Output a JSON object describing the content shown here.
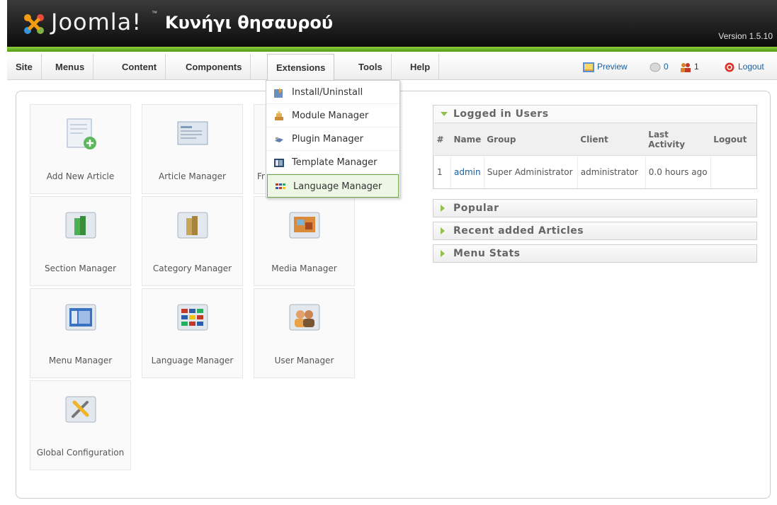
{
  "header": {
    "logo_text": "Joomla!",
    "logo_tm": "™",
    "site_name": "Κυνήγι θησαυρού",
    "version": "Version 1.5.10"
  },
  "menubar": {
    "items": [
      {
        "label": "Site"
      },
      {
        "label": "Menus"
      },
      {
        "label": "Content"
      },
      {
        "label": "Components"
      },
      {
        "label": "Extensions"
      },
      {
        "label": "Tools"
      },
      {
        "label": "Help"
      }
    ],
    "preview_label": "Preview",
    "messages_count": "0",
    "users_count": "1",
    "logout_label": "Logout"
  },
  "extensions_dropdown": {
    "items": [
      {
        "label": "Install/Uninstall",
        "icon": "install-icon"
      },
      {
        "label": "Module Manager",
        "icon": "module-icon"
      },
      {
        "label": "Plugin Manager",
        "icon": "plugin-icon"
      },
      {
        "label": "Template Manager",
        "icon": "template-icon"
      },
      {
        "label": "Language Manager",
        "icon": "language-icon"
      }
    ]
  },
  "quick_icons": [
    {
      "label": "Add New Article",
      "icon": "add-article-icon"
    },
    {
      "label": "Article Manager",
      "icon": "article-manager-icon"
    },
    {
      "label": "Fr",
      "icon": "frontpage-manager-icon"
    },
    {
      "label": "Section Manager",
      "icon": "section-manager-icon"
    },
    {
      "label": "Category Manager",
      "icon": "category-manager-icon"
    },
    {
      "label": "Media Manager",
      "icon": "media-manager-icon"
    },
    {
      "label": "Menu Manager",
      "icon": "menu-manager-icon"
    },
    {
      "label": "Language Manager",
      "icon": "language-manager-icon"
    },
    {
      "label": "User Manager",
      "icon": "user-manager-icon"
    },
    {
      "label": "Global Configuration",
      "icon": "global-configuration-icon"
    }
  ],
  "panels": {
    "logged_in": {
      "title": "Logged in Users",
      "columns": [
        "#",
        "Name",
        "Group",
        "Client",
        "Last Activity",
        "Logout"
      ],
      "rows": [
        {
          "num": "1",
          "name": "admin",
          "group": "Super Administrator",
          "client": "administrator",
          "last_activity": "0.0 hours ago",
          "logout": ""
        }
      ]
    },
    "popular": {
      "title": "Popular"
    },
    "recent": {
      "title": "Recent added Articles"
    },
    "menu_stats": {
      "title": "Menu Stats"
    }
  },
  "colors": {
    "header_dark": "#1a1a1a",
    "header_green": "#6bb62a",
    "link_blue": "#1a5d9c",
    "panel_arrow": "#8fc24a"
  }
}
